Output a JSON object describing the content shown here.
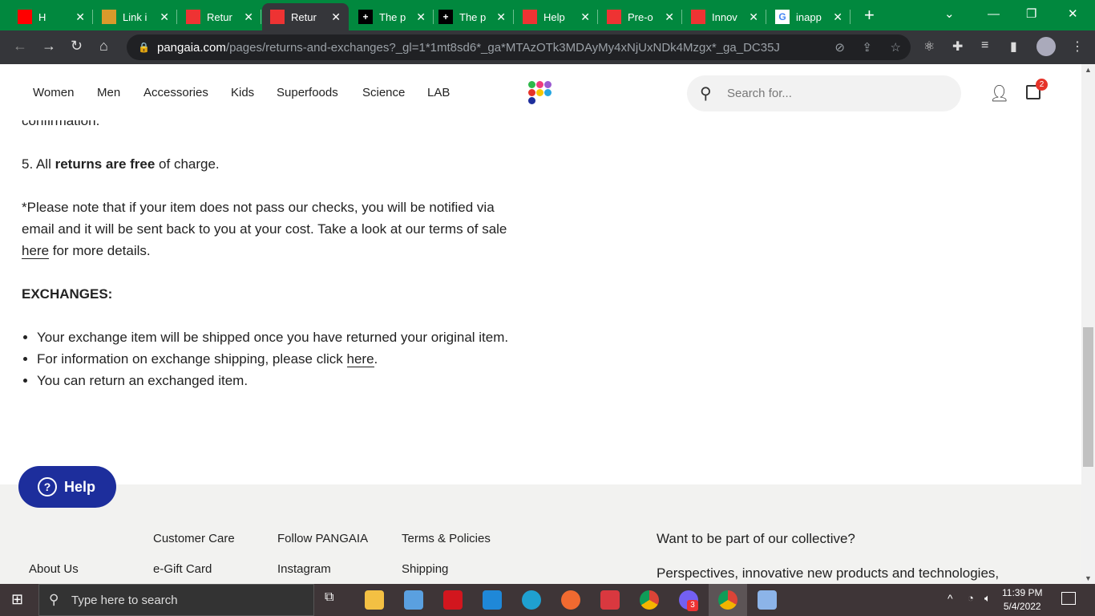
{
  "browser": {
    "tabs": [
      {
        "title": "H",
        "icon": "youtube-icon",
        "color": "#ff0000"
      },
      {
        "title": "Link i",
        "icon": "trello-icon",
        "color": "#d99a2b"
      },
      {
        "title": "Retur",
        "icon": "pangaia-icon",
        "color": "#e33"
      },
      {
        "title": "Retur",
        "icon": "pangaia-icon",
        "color": "#e33",
        "active": true
      },
      {
        "title": "The p",
        "icon": "plus-icon",
        "color": "#000"
      },
      {
        "title": "The p",
        "icon": "plus-icon",
        "color": "#000"
      },
      {
        "title": "Help",
        "icon": "pangaia-icon",
        "color": "#e33"
      },
      {
        "title": "Pre-o",
        "icon": "pangaia-icon",
        "color": "#e33"
      },
      {
        "title": "Innov",
        "icon": "pangaia-icon",
        "color": "#e33"
      },
      {
        "title": "inapp",
        "icon": "google-icon",
        "color": "#fff"
      }
    ],
    "url_host": "pangaia.com",
    "url_path": "/pages/returns-and-exchanges?_gl=1*1mt8sd6*_ga*MTAzOTk3MDAyMy4xNjUxNDk4Mzgx*_ga_DC35J2..."
  },
  "header": {
    "nav": [
      "Women",
      "Men",
      "Accessories",
      "Kids",
      "Superfoods",
      "Science",
      "LAB"
    ],
    "search_placeholder": "Search for...",
    "cart_count": "2"
  },
  "content": {
    "cut_line": "confirmation.",
    "item5_prefix": "5. All ",
    "item5_bold": "returns are free",
    "item5_suffix": " of charge.",
    "note_1": "*Please note that if your item does not pass our checks, you will be notified via email and it will be sent back to you at your cost. Take a look at our terms of sale ",
    "note_link": "here",
    "note_2": " for more details.",
    "exchanges_heading": "EXCHANGES:",
    "bullet1": "Your exchange item will be shipped once you have returned your original item.",
    "bullet2_prefix": "For information on exchange shipping, please click ",
    "bullet2_link": "here",
    "bullet2_suffix": ".",
    "bullet3": "You can return an exchanged item."
  },
  "footer": {
    "col1_item": "About Us",
    "customer_care": "Customer Care",
    "gift_card": "e-Gift Card",
    "follow": "Follow PANGAIA",
    "instagram": "Instagram",
    "terms": "Terms & Policies",
    "shipping": "Shipping",
    "newsletter_title": "Want to be part of our collective?",
    "newsletter_text": "Perspectives, innovative new products and technologies,"
  },
  "help_button": "Help",
  "taskbar": {
    "search_placeholder": "Type here to search",
    "time": "11:39 PM",
    "date": "5/4/2022",
    "viber_badge": "3"
  }
}
